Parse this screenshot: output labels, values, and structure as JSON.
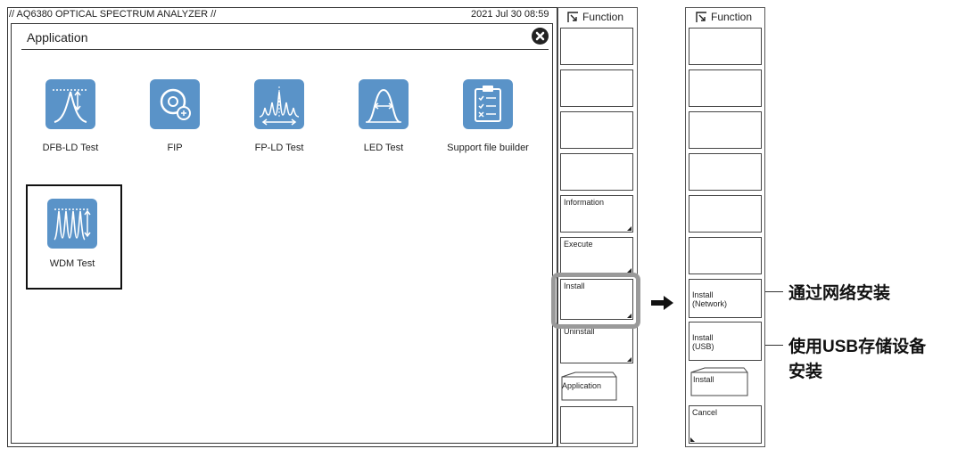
{
  "screen": {
    "title": "// AQ6380 OPTICAL SPECTRUM ANALYZER //",
    "datetime": "2021 Jul 30 08:59"
  },
  "application_dialog": {
    "title": "Application",
    "apps": [
      {
        "label": "DFB-LD Test",
        "icon": "dfb-ld-icon"
      },
      {
        "label": "FIP",
        "icon": "fip-icon"
      },
      {
        "label": "FP-LD Test",
        "icon": "fp-ld-icon"
      },
      {
        "label": "LED Test",
        "icon": "led-icon"
      },
      {
        "label": "Support file builder",
        "icon": "clipboard-icon"
      },
      {
        "label": "WDM Test",
        "icon": "wdm-icon",
        "selected": true
      }
    ]
  },
  "function_panel_before": {
    "header": "Function",
    "softkeys": [
      "",
      "",
      "",
      "",
      "Information",
      "Execute",
      "Install",
      "Uninstall",
      "Application",
      ""
    ]
  },
  "function_panel_after": {
    "header": "Function",
    "softkeys": [
      "",
      "",
      "",
      "",
      "",
      "",
      "Install\n(Network)",
      "Install\n(USB)",
      "Install",
      "Cancel"
    ]
  },
  "annotations": {
    "network_install": "通过网络安装",
    "usb_install_line1": "使用USB存储设备",
    "usb_install_line2": "安装"
  },
  "colors": {
    "icon_blue": "#5a93c8",
    "highlight_gray": "#9a9a9a"
  }
}
